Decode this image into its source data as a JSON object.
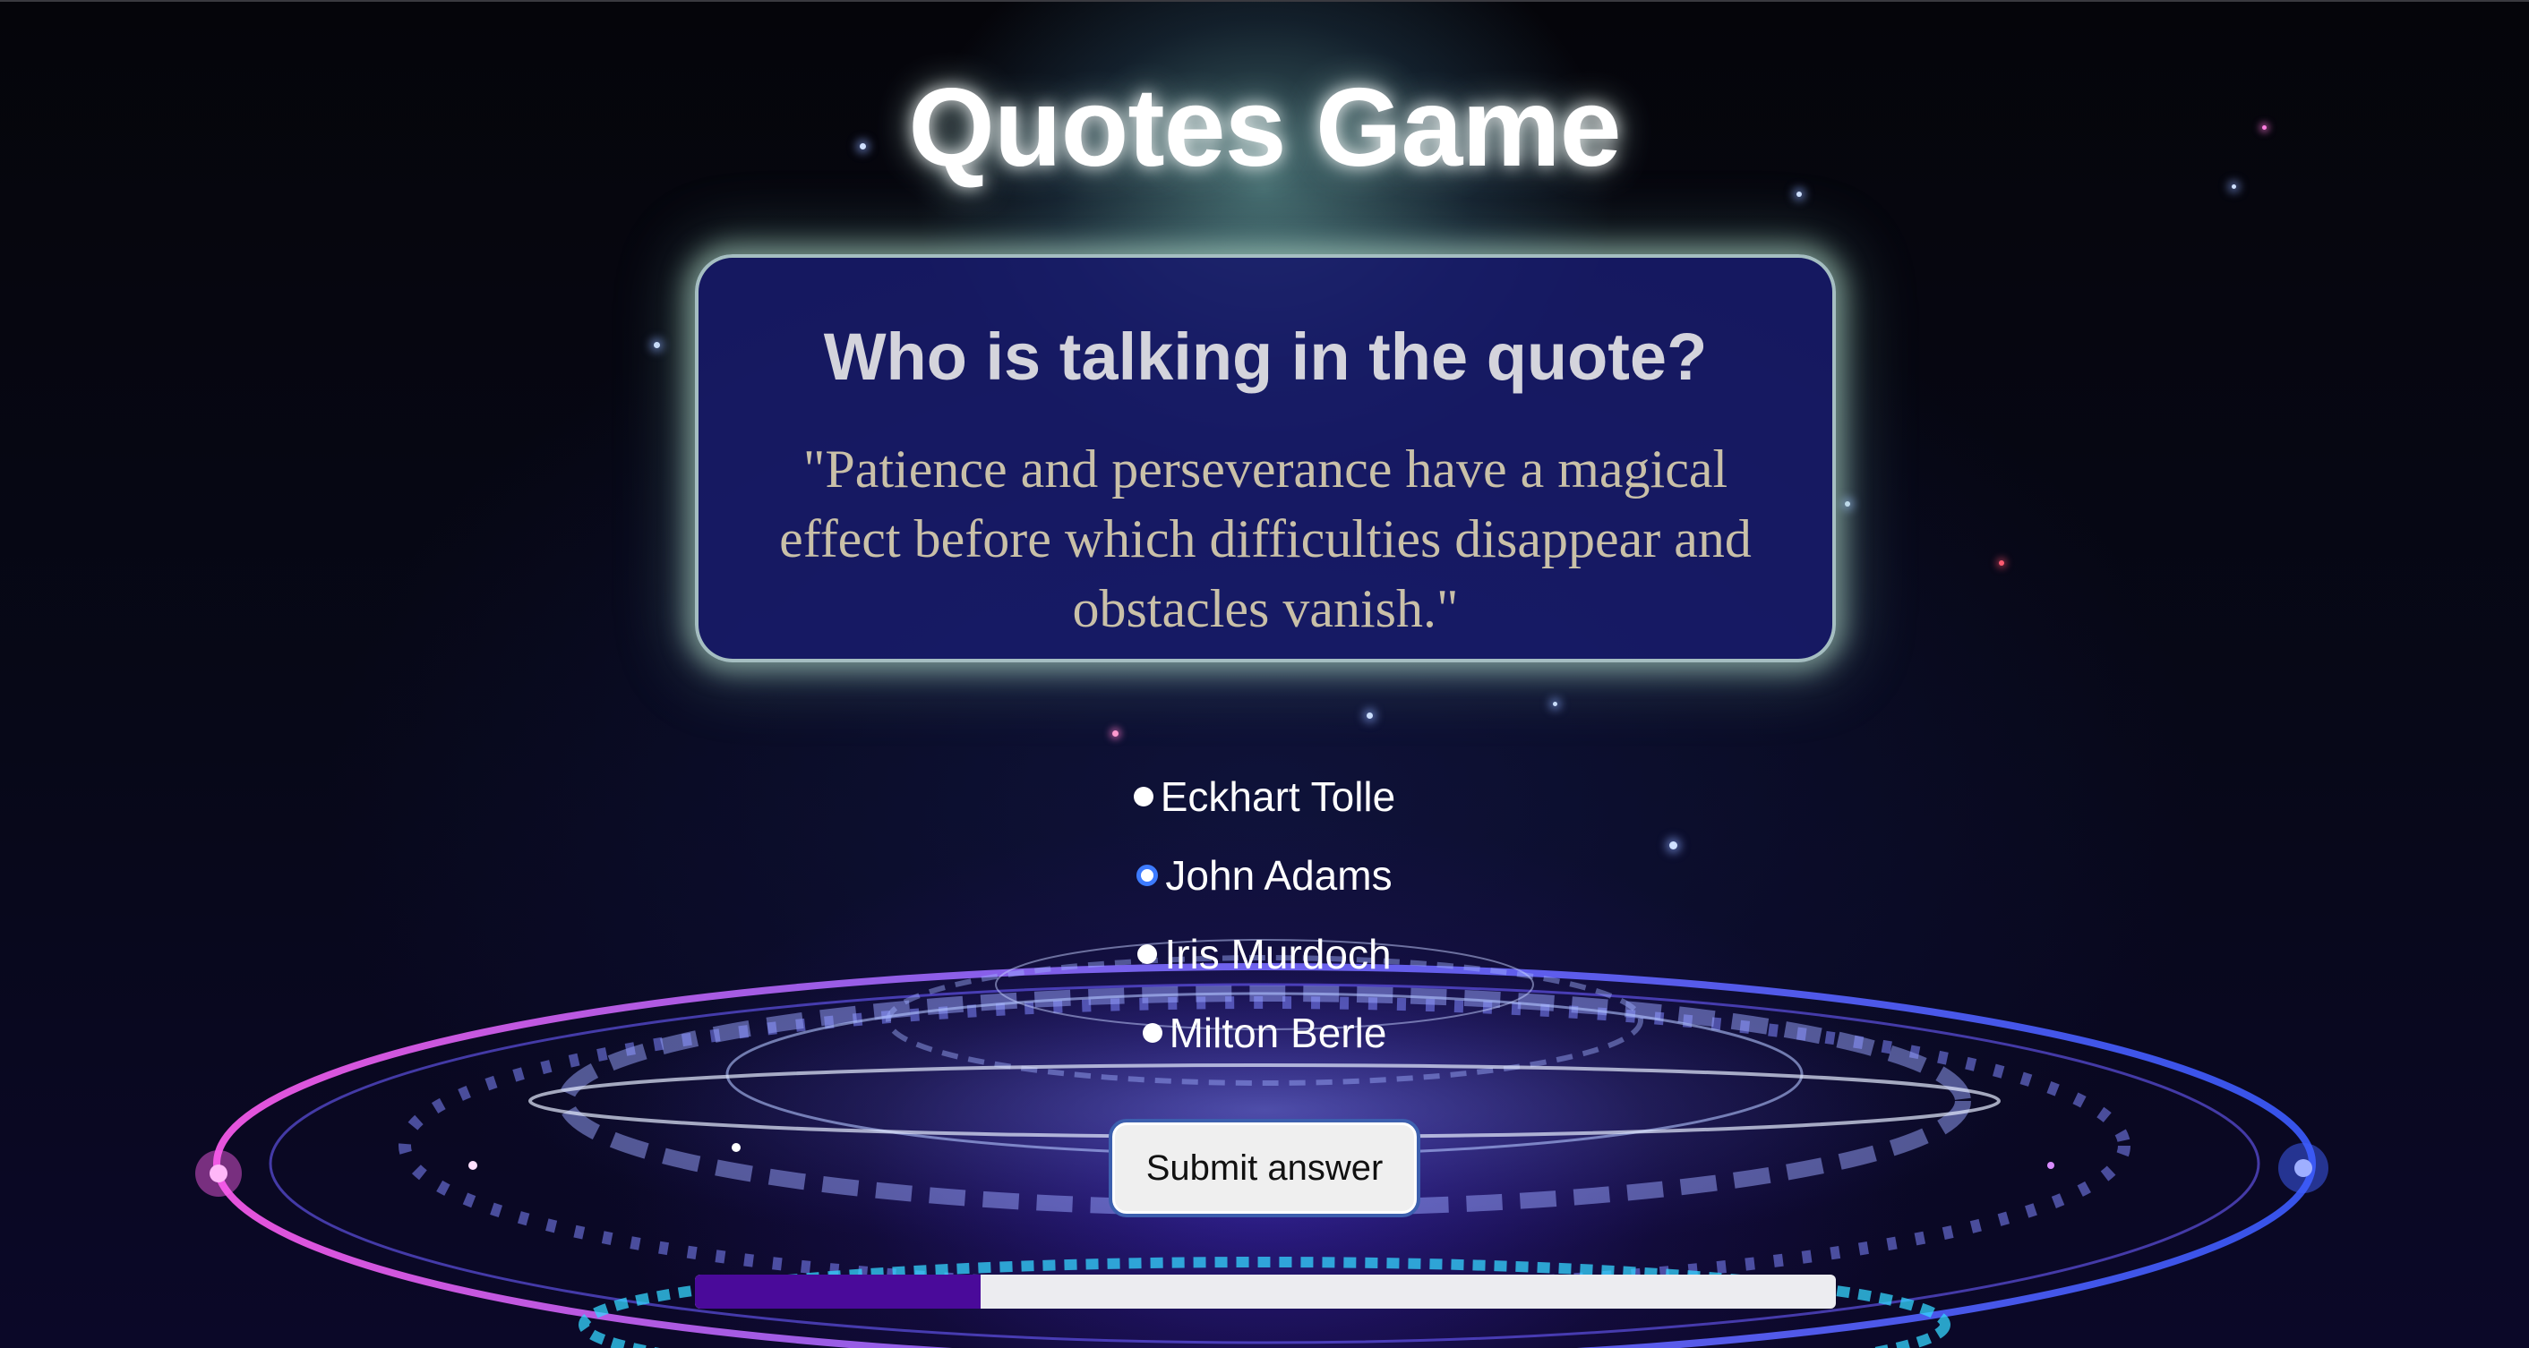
{
  "app": {
    "title": "Quotes Game"
  },
  "question": {
    "prompt": "Who is talking in the quote?",
    "quote": "\"Patience and perseverance have a magical effect before which difficulties disappear and obstacles vanish.\""
  },
  "options": [
    {
      "label": "Eckhart Tolle",
      "selected": false
    },
    {
      "label": "John Adams",
      "selected": true
    },
    {
      "label": "Iris Murdoch",
      "selected": false
    },
    {
      "label": "Milton Berle",
      "selected": false
    }
  ],
  "submit": {
    "label": "Submit answer"
  },
  "progress": {
    "fraction": 0.25,
    "fill_color": "#4a0a9a",
    "track_color": "#ececf0"
  },
  "colors": {
    "card_background": "#181c6e",
    "title_color": "#ffffff",
    "radio_selected": "#3d7bff"
  }
}
